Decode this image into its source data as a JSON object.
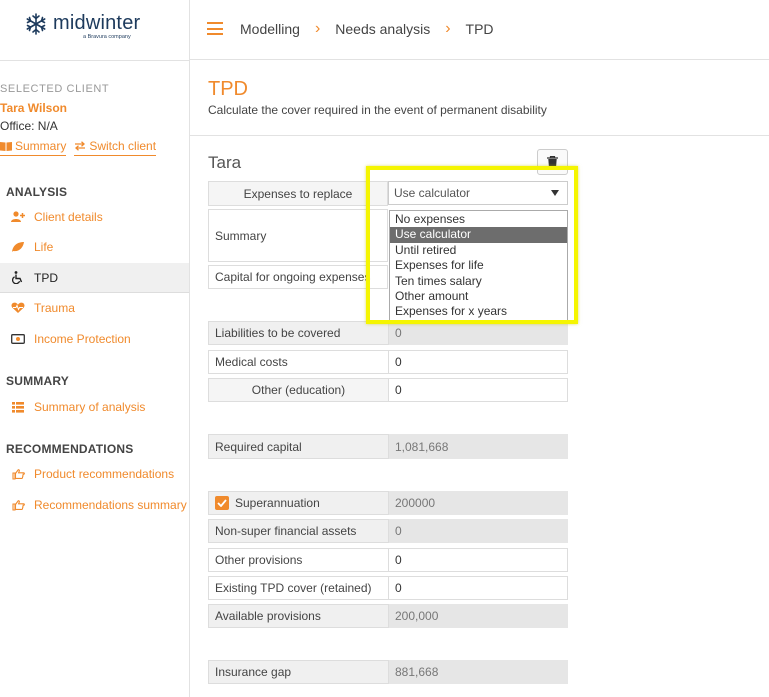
{
  "brand": {
    "name": "midwinter",
    "tagline": "a Bravura company",
    "accent": "#f08a2c"
  },
  "header": {
    "menu_icon": "hamburger-icon",
    "breadcrumbs": [
      "Modelling",
      "Needs analysis",
      "TPD"
    ]
  },
  "sidebar": {
    "selected_label": "SELECTED CLIENT",
    "client_name": "Tara Wilson",
    "office": "Office: N/A",
    "summary_link": "Summary",
    "switch_link": "Switch client",
    "sections": [
      {
        "title": "ANALYSIS",
        "items": [
          {
            "label": "Client details",
            "icon": "add-user-icon"
          },
          {
            "label": "Life",
            "icon": "leaf-icon"
          },
          {
            "label": "TPD",
            "icon": "wheelchair-icon"
          },
          {
            "label": "Trauma",
            "icon": "heartbeat-icon"
          },
          {
            "label": "Income Protection",
            "icon": "money-icon"
          }
        ]
      },
      {
        "title": "SUMMARY",
        "items": [
          {
            "label": "Summary of analysis",
            "icon": "list-icon"
          }
        ]
      },
      {
        "title": "RECOMMENDATIONS",
        "items": [
          {
            "label": "Product recommendations",
            "icon": "pointing-hand-icon"
          },
          {
            "label": "Recommendations summary",
            "icon": "pointing-hand-icon"
          }
        ]
      }
    ]
  },
  "page": {
    "title": "TPD",
    "subtitle": "Calculate the cover required in the event of permanent disability",
    "person": "Tara"
  },
  "form": {
    "expenses_label": "Expenses to replace",
    "expenses_value": "Use calculator",
    "expenses_options": [
      "No expenses",
      "Use calculator",
      "Until retired",
      "Expenses for life",
      "Ten times salary",
      "Other amount",
      "Expenses for x years"
    ],
    "summary_label": "Summary",
    "capital_label": "Capital for ongoing expenses",
    "liabilities_label": "Liabilities to be covered",
    "liabilities_value": "0",
    "medical_label": "Medical costs",
    "medical_value": "0",
    "other_label": "Other (education)",
    "other_value": "0",
    "required_label": "Required capital",
    "required_value": "1,081,668",
    "super_label": "Superannuation",
    "super_value": "200000",
    "nonsuper_label": "Non-super financial assets",
    "nonsuper_value": "0",
    "otherprov_label": "Other provisions",
    "otherprov_value": "0",
    "existing_label": "Existing TPD cover (retained)",
    "existing_value": "0",
    "available_label": "Available provisions",
    "available_value": "200,000",
    "gap_label": "Insurance gap",
    "gap_value": "881,668"
  }
}
